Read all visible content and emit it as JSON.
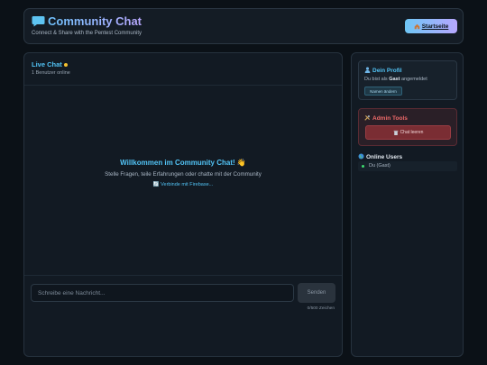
{
  "header": {
    "title": "Community Chat",
    "subtitle": "Connect & Share with the Pentest Community",
    "home_button": "Startseite",
    "home_icon": "house-icon"
  },
  "chat": {
    "title": "Live Chat",
    "users_online": "1 Benutzer online",
    "welcome_title": "Willkommen im Community Chat! 👋",
    "welcome_subtitle": "Stelle Fragen, teile Erfahrungen oder chatte mit der Community",
    "status": "🔄 Verbinde mit Firebase...",
    "input_placeholder": "Schreibe eine Nachricht...",
    "send_label": "Senden",
    "char_count": "0/500 Zeichen"
  },
  "sidebar": {
    "profile": {
      "title": "Dein Profil",
      "text_prefix": "Du bist als",
      "user": "Gast",
      "text_suffix": "angemeldet",
      "rename_button": "Namen ändern"
    },
    "admin": {
      "title": "Admin Tools",
      "clear_button": "Chat leeren"
    },
    "online": {
      "title": "Online Users",
      "users": [
        "Du (Gast)"
      ]
    }
  },
  "colors": {
    "accent": "#52c3f5",
    "danger": "#f06a6a",
    "online": "#3ddc6f",
    "status_dot": "#f5c12e"
  }
}
